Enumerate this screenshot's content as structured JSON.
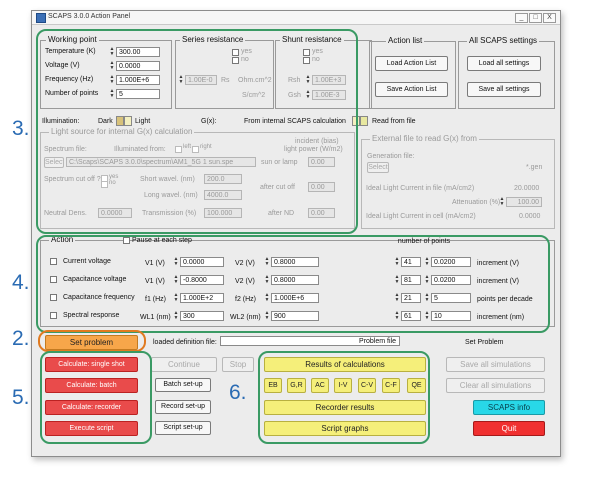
{
  "window": {
    "title": "SCAPS 3.0.0 Action Panel",
    "controls": [
      "_",
      "□",
      "X"
    ]
  },
  "working_point": {
    "legend": "Working point",
    "rows": [
      {
        "label": "Temperature (K)",
        "value": "300.00"
      },
      {
        "label": "Voltage (V)",
        "value": "0.0000"
      },
      {
        "label": "Frequency (Hz)",
        "value": "1.000E+6"
      },
      {
        "label": "Number of points",
        "value": "5"
      }
    ]
  },
  "series_resistance": {
    "legend": "Series resistance",
    "yes": "yes",
    "no": "no",
    "value": "1.00E-0",
    "unit_label": "Rs",
    "unit": "Ohm.cm^2",
    "s_label": "S/cm^2"
  },
  "shunt_resistance": {
    "legend": "Shunt resistance",
    "yes": "yes",
    "no": "no",
    "r_label": "Rsh",
    "r_value": "1.00E+3",
    "g_label": "Gsh",
    "g_value": "1.00E-3"
  },
  "action_list": {
    "legend": "Action list",
    "load": "Load Action List",
    "save": "Save Action List"
  },
  "all_settings": {
    "legend": "All SCAPS settings",
    "load": "Load all settings",
    "save": "Save all settings"
  },
  "illumination": {
    "label": "Illumination:",
    "dark": "Dark",
    "light": "Light",
    "g_label": "G(x):",
    "from_internal": "From internal SCAPS calculation",
    "read_file": "Read from file"
  },
  "light_source": {
    "legend": "Light source for internal G(x) calculation",
    "illuminated_from": "Illuminated from:",
    "left": "left",
    "right": "right",
    "incident_label": "incident (bias)",
    "light_power": "light power (W/m2)",
    "spectrum_file_label": "Spectrum file:",
    "select": "Select",
    "spectrum_file": "C:\\Scaps\\SCAPS 3.0.0\\spectrum\\AM1_5G 1 sun.spe",
    "sun_or_lamp": "sun or lamp",
    "sun_value": "0.00",
    "cut_off_label": "Spectrum cut off ?",
    "yes": "yes",
    "no": "no",
    "short_wavel": "Short wavel. (nm)",
    "short_value": "200.0",
    "long_wavel": "Long wavel. (nm)",
    "long_value": "4000.0",
    "after_cut_off": "after cut off",
    "after_cut_value": "0.00",
    "nd_filter": "Neutral Dens.",
    "nd_value": "0.0000",
    "transmission": "Transmission (%)",
    "trans_value": "100.000",
    "after_nd": "after ND",
    "after_nd_value": "0.00"
  },
  "external_file": {
    "legend": "External file to read G(x) from",
    "gen_file": "Generation file:",
    "select": "Select",
    "ext": "*.gen",
    "ideal_current_file": "Ideal Light Current in file (mA/cm2)",
    "ideal_current_value": "20.0000",
    "attenuation": "Attenuation (%)",
    "attenuation_value": "100.00",
    "ideal_current_cell": "Ideal Light Current in cell (mA/cm2)",
    "ideal_cell_value": "0.0000"
  },
  "action": {
    "legend": "Action",
    "pause": "Pause at each step",
    "number_of_points": "number of points",
    "rows": [
      {
        "name": "Current voltage",
        "l1": "V1 (V)",
        "v1": "0.0000",
        "l2": "V2 (V)",
        "v2": "0.8000",
        "n": "41",
        "inc": "0.0200",
        "unit": "increment (V)"
      },
      {
        "name": "Capacitance voltage",
        "l1": "V1 (V)",
        "v1": "-0.8000",
        "l2": "V2 (V)",
        "v2": "0.8000",
        "n": "81",
        "inc": "0.0200",
        "unit": "increment (V)"
      },
      {
        "name": "Capacitance frequency",
        "l1": "f1 (Hz)",
        "v1": "1.000E+2",
        "l2": "f2 (Hz)",
        "v2": "1.000E+6",
        "n": "21",
        "inc": "5",
        "unit": "points per decade"
      },
      {
        "name": "Spectral response",
        "l1": "WL1 (nm)",
        "v1": "300",
        "l2": "WL2 (nm)",
        "v2": "900",
        "n": "61",
        "inc": "10",
        "unit": "increment (nm)"
      }
    ]
  },
  "problem": {
    "set_problem": "Set problem",
    "loaded_label": "loaded definition file:",
    "file": "Problem file",
    "status": "Set Problem"
  },
  "buttons": {
    "calc_single": "Calculate: single shot",
    "calc_batch": "Calculate: batch",
    "calc_recorder": "Calculate: recorder",
    "execute_script": "Execute script",
    "continue": "Continue",
    "stop": "Stop",
    "batch_setup": "Batch set-up",
    "record_setup": "Record set-up",
    "script_setup": "Script set-up",
    "results": "Results of calculations",
    "eb": "EB",
    "gr": "G,R",
    "ac": "AC",
    "iv": "I-V",
    "cv": "C-V",
    "cf": "C-F",
    "qe": "QE",
    "recorder_results": "Recorder results",
    "script_graphs": "Script graphs",
    "save_all_sim": "Save all simulations",
    "clear_all_sim": "Clear all simulations",
    "info": "SCAPS info",
    "quit": "Quit"
  },
  "annotations": {
    "n2": "2.",
    "n3": "3.",
    "n4": "4.",
    "n5": "5.",
    "n6": "6."
  },
  "colors": {
    "highlight": "#3a9a64",
    "annotation": "#2a6bb3",
    "calc_red": "#e94b4b",
    "yellow": "#f5ef7a",
    "orange": "#f7a64a",
    "cyan": "#28d8e8",
    "quit_red": "#f03030"
  }
}
